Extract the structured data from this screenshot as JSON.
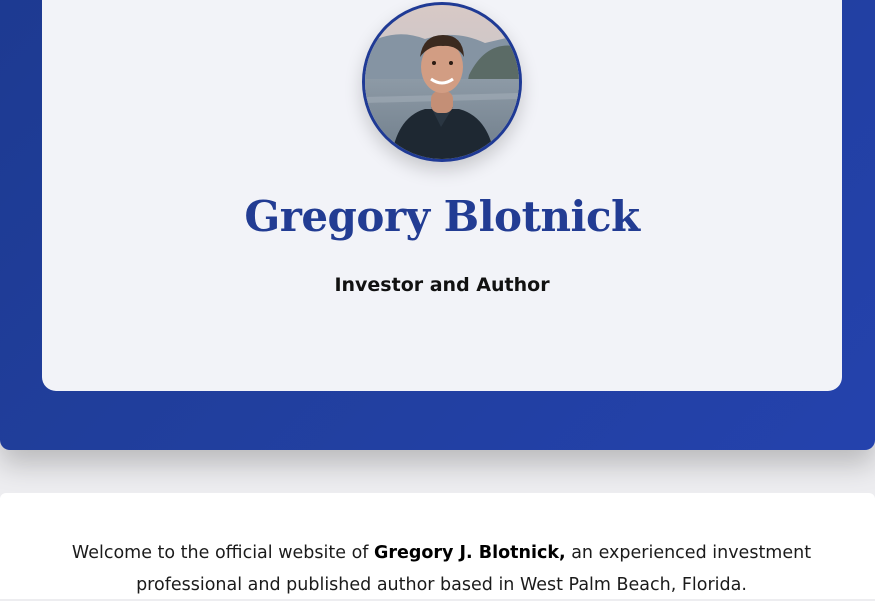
{
  "hero": {
    "name": "Gregory Blotnick",
    "subtitle": "Investor and Author",
    "avatar_icon": "profile-photo"
  },
  "intro": {
    "text_before": "Welcome to the official website of ",
    "name_bold": "Gregory J. Blotnick,",
    "text_after": " an experienced investment professional and published author based in West Palm Beach, Florida."
  },
  "colors": {
    "brand_blue": "#213f9e",
    "name_blue": "#223c93",
    "card_bg": "#f2f3f8"
  }
}
